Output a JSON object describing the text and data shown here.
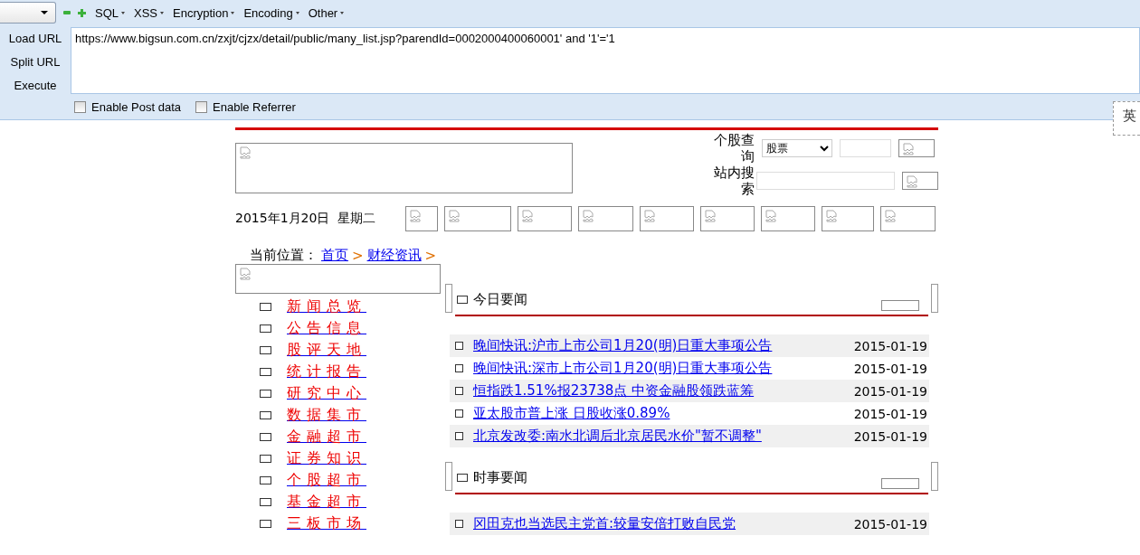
{
  "toolbar": {
    "menus": [
      "SQL",
      "XSS",
      "Encryption",
      "Encoding",
      "Other"
    ],
    "actions": [
      "Load URL",
      "Split URL",
      "Execute"
    ],
    "url": "https://www.bigsun.com.cn/zxjt/cjzx/detail/public/many_list.jsp?parendId=0002000400060001' and '1'='1",
    "options": [
      {
        "label": "Enable Post data",
        "checked": false
      },
      {
        "label": "Enable Referrer",
        "checked": false
      }
    ]
  },
  "ime_indicator": "英",
  "page": {
    "stock_query_label": "个股查询",
    "stock_type": "股票",
    "site_search_label": "站内搜索",
    "date": "2015年1月20日  星期二",
    "breadcrumb": {
      "label": "当前位置：",
      "links": [
        {
          "text": "首页",
          "separator": ">"
        },
        {
          "text": "财经资讯",
          "separator": ">"
        }
      ]
    },
    "nav": [
      "新闻总览",
      "公告信息",
      "股评天地",
      "统计报告",
      "研究中心",
      "数据集市",
      "金融超市",
      "证券知识",
      "个股超市",
      "基金超市",
      "三板市场"
    ],
    "sections": [
      {
        "title": "今日要闻",
        "news": [
          {
            "title": "晚间快讯:沪市上市公司1月20(明)日重大事项公告",
            "date": "2015-01-19"
          },
          {
            "title": "晚间快讯:深市上市公司1月20(明)日重大事项公告",
            "date": "2015-01-19"
          },
          {
            "title": "恒指跌1.51%报23738点 中资金融股领跌蓝筹",
            "date": "2015-01-19"
          },
          {
            "title": "亚太股市普上涨 日股收涨0.89%",
            "date": "2015-01-19"
          },
          {
            "title": "北京发改委:南水北调后北京居民水价\"暂不调整\"",
            "date": "2015-01-19"
          }
        ]
      },
      {
        "title": "时事要闻",
        "news": [
          {
            "title": "冈田克也当选民主党首:较量安倍打败自民党",
            "date": "2015-01-19"
          }
        ]
      }
    ]
  }
}
